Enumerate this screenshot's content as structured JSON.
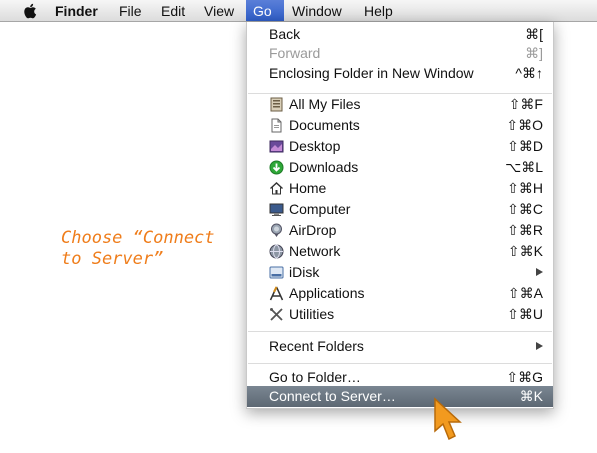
{
  "menubar": {
    "apple": "",
    "items": [
      "Finder",
      "File",
      "Edit",
      "View",
      "Go",
      "Window",
      "Help"
    ]
  },
  "menu": {
    "back": {
      "label": "Back",
      "shortcut": "⌘["
    },
    "forward": {
      "label": "Forward",
      "shortcut": "⌘]"
    },
    "enclosing": {
      "label": "Enclosing Folder in New Window",
      "shortcut": "^⌘↑"
    },
    "places": [
      {
        "label": "All My Files",
        "shortcut": "⇧⌘F"
      },
      {
        "label": "Documents",
        "shortcut": "⇧⌘O"
      },
      {
        "label": "Desktop",
        "shortcut": "⇧⌘D"
      },
      {
        "label": "Downloads",
        "shortcut": "⌥⌘L"
      },
      {
        "label": "Home",
        "shortcut": "⇧⌘H"
      },
      {
        "label": "Computer",
        "shortcut": "⇧⌘C"
      },
      {
        "label": "AirDrop",
        "shortcut": "⇧⌘R"
      },
      {
        "label": "Network",
        "shortcut": "⇧⌘K"
      },
      {
        "label": "iDisk",
        "shortcut": ""
      },
      {
        "label": "Applications",
        "shortcut": "⇧⌘A"
      },
      {
        "label": "Utilities",
        "shortcut": "⇧⌘U"
      }
    ],
    "recent": {
      "label": "Recent Folders"
    },
    "goto": {
      "label": "Go to Folder…",
      "shortcut": "⇧⌘G"
    },
    "connect": {
      "label": "Connect to Server…",
      "shortcut": "⌘K"
    }
  },
  "annotation": {
    "line1": "Choose “Connect",
    "line2": "to Server”"
  },
  "colors": {
    "accent_orange": "#ef7d1b",
    "menu_highlight": "#5d6873",
    "menubar_active": "#3a66cc"
  }
}
